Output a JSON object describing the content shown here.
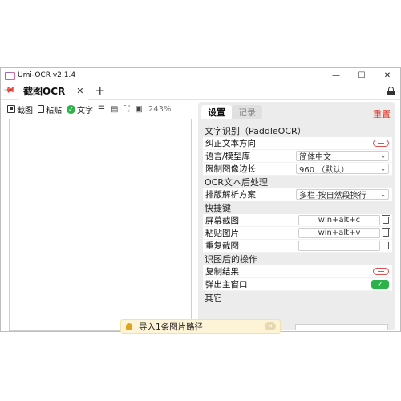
{
  "window": {
    "title": "Umi-OCR v2.1.4",
    "minimize": "—",
    "maximize": "☐",
    "close": "✕"
  },
  "tabbar": {
    "tab_label": "截图OCR",
    "tab_close": "✕",
    "add": "+"
  },
  "left_toolbar": {
    "screenshot_label": "截图",
    "paste_label": "粘贴",
    "text_label": "文字",
    "zoom": "243%"
  },
  "right_tabs": {
    "settings": "设置",
    "records": "记录",
    "reset": "重置"
  },
  "settings": {
    "ocr_section": "文字识别（PaddleOCR）",
    "correct_direction": "纠正文本方向",
    "language_label": "语言/模型库",
    "language_value": "简体中文",
    "limit_label": "限制图像边长",
    "limit_value": "960 （默认）",
    "post_section": "OCR文本后处理",
    "layout_label": "排版解析方案",
    "layout_value": "多栏-按自然段换行",
    "hotkey_section": "快捷键",
    "screen_capture_label": "屏幕截图",
    "screen_capture_value": "win+alt+c",
    "paste_image_label": "粘贴图片",
    "paste_image_value": "win+alt+v",
    "repeat_capture_label": "重复截图",
    "repeat_capture_value": "",
    "after_section": "识图后的操作",
    "copy_result_label": "复制结果",
    "popup_label": "弹出主窗口",
    "other_section": "其它"
  },
  "toast": {
    "message": "导入1条图片路径"
  },
  "colors": {
    "accent_green": "#2bb34a",
    "danger_red": "#e53b2e"
  }
}
